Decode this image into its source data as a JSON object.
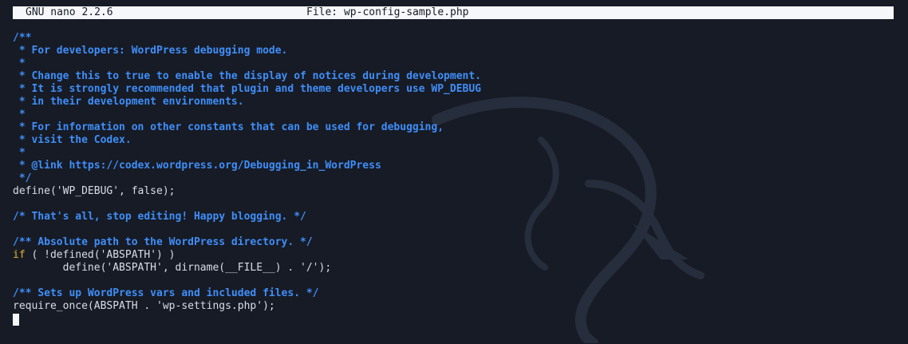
{
  "titlebar": {
    "app": "GNU nano 2.2.6",
    "file": "File: wp-config-sample.php"
  },
  "editor": {
    "lines": [
      {
        "type": "blank",
        "text": ""
      },
      {
        "type": "comment",
        "text": "/**"
      },
      {
        "type": "comment",
        "text": " * For developers: WordPress debugging mode."
      },
      {
        "type": "comment",
        "text": " *"
      },
      {
        "type": "comment",
        "text": " * Change this to true to enable the display of notices during development."
      },
      {
        "type": "comment",
        "text": " * It is strongly recommended that plugin and theme developers use WP_DEBUG"
      },
      {
        "type": "comment",
        "text": " * in their development environments."
      },
      {
        "type": "comment",
        "text": " *"
      },
      {
        "type": "comment",
        "text": " * For information on other constants that can be used for debugging,"
      },
      {
        "type": "comment",
        "text": " * visit the Codex."
      },
      {
        "type": "comment",
        "text": " *"
      },
      {
        "type": "comment",
        "text": " * @link https://codex.wordpress.org/Debugging_in_WordPress"
      },
      {
        "type": "comment",
        "text": " */"
      },
      {
        "type": "code",
        "text": "define('WP_DEBUG', false);"
      },
      {
        "type": "blank",
        "text": ""
      },
      {
        "type": "comment",
        "text": "/* That's all, stop editing! Happy blogging. */"
      },
      {
        "type": "blank",
        "text": ""
      },
      {
        "type": "comment",
        "text": "/** Absolute path to the WordPress directory. */"
      },
      {
        "type": "keyword_line",
        "keyword": "if",
        "text": " ( !defined('ABSPATH') )"
      },
      {
        "type": "code",
        "text": "        define('ABSPATH', dirname(__FILE__) . '/');"
      },
      {
        "type": "blank",
        "text": ""
      },
      {
        "type": "comment",
        "text": "/** Sets up WordPress vars and included files. */"
      },
      {
        "type": "code",
        "text": "require_once(ABSPATH . 'wp-settings.php');"
      },
      {
        "type": "cursor",
        "text": ""
      }
    ]
  },
  "colors": {
    "background": "#171b25",
    "comment": "#3f8ef8",
    "code": "#d8dde8",
    "keyword": "#e5b42b",
    "titlebar_bg": "#f5f7fb"
  },
  "icons": {
    "watermark": "kali-dragon-icon"
  }
}
